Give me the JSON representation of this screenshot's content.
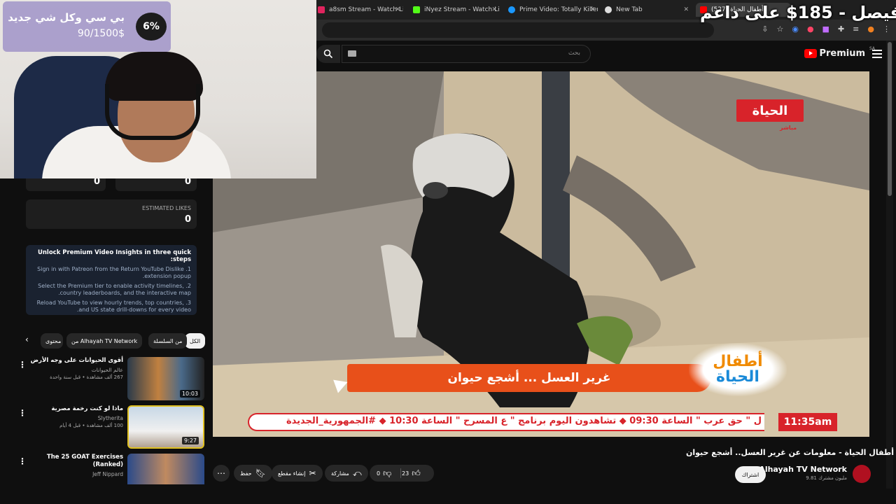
{
  "browser": {
    "tabs": [
      {
        "label": "a8sm Stream - Watch Live",
        "color": "#e0245e"
      },
      {
        "label": "iNyez Stream - Watch Live",
        "color": "#53fc18"
      },
      {
        "label": "Prime Video: Totally Killer",
        "color": "#1a98ff"
      },
      {
        "label": "New Tab",
        "color": "#dddddd"
      },
      {
        "label": "(527) أطفال الحياة",
        "color": "#ff0000"
      }
    ]
  },
  "overlay": {
    "goal_percent": "6%",
    "goal_title": "بي سي وكل شي جديد",
    "goal_amount": "90/1500$",
    "donation_text": "فيصل - 185$ على داعم"
  },
  "youtube": {
    "search_placeholder": "بحث",
    "premium_label": "Premium",
    "region": "SA"
  },
  "left_panel": {
    "stat_top_left": "0",
    "stat_top_right": "0",
    "estimated_likes_label": "ESTIMATED LIKES",
    "estimated_likes_value": "0",
    "insights_title": "Unlock Premium Video Insights in three quick steps:",
    "insights_steps": [
      "1. Sign in with Patreon from the Return YouTube Dislike extension popup.",
      "2. Select the Premium tier to enable activity timelines, country leaderboards, and the interactive map.",
      "3. Reload YouTube to view hourly trends, top countries, and US state drill-downs for every video."
    ],
    "chips": [
      "الكل",
      "من السلسلة",
      "من Alhayah TV Network",
      "محتوى"
    ],
    "recommendations": [
      {
        "title": "أقوى الحيوانات على وجه الأرض",
        "channel": "عالم الحيوانات",
        "meta": "267 ألف مشاهدة • قبل سنة واحدة",
        "duration": "10:03"
      },
      {
        "title": "ماذا لو كنت رخمة مصرية",
        "channel": "Slytherita",
        "meta": "100 ألف مشاهدة • قبل 4 أيام",
        "duration": "9:27"
      },
      {
        "title": "The 25 GOAT Exercises (Ranked)",
        "channel": "Jeff Nippard",
        "meta": "",
        "duration": ""
      }
    ]
  },
  "video": {
    "channel_logo": "الحياة",
    "live_tag": "مباشر",
    "lower_third": "غرير العسل ... أشجع حيوان",
    "show_logo_line1": "أطفال",
    "show_logo_line2": "الحياة",
    "ticker_time": "11:35am",
    "ticker_text": "ل \" حق عرب \" الساعة 09:30  ◆  تشاهدون اليوم برنامج \" ع المسرح \" الساعة 10:30  ◆  #الجمهورية_الجديدة",
    "title": "أطفال الحياة - معلومات عن غرير العسل.. أشجع حيوان",
    "channel_name": "Alhayah TV Network",
    "subscribers": "9.81 مليون مشترك",
    "subscribe_label": "اشتراك",
    "likes": "23",
    "dislikes": "0",
    "share_label": "مشاركة",
    "clip_label": "إنشاء مقطع",
    "save_label": "حفظ"
  }
}
